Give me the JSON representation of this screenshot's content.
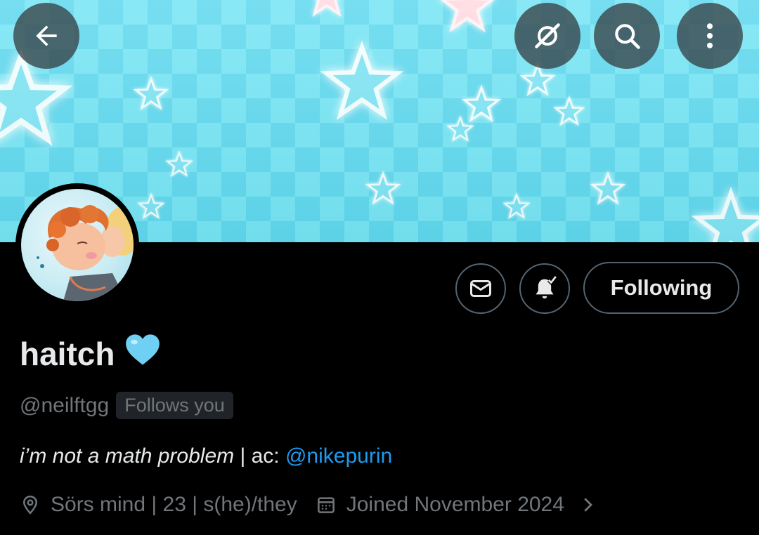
{
  "header": {
    "back_icon": "arrow-left-icon",
    "grok_icon": "grok-icon",
    "search_icon": "search-icon",
    "more_icon": "more-vertical-icon"
  },
  "profile": {
    "display_name": "haitch",
    "name_emoji": "🩵",
    "handle": "@neilftgg",
    "follows_you": "Follows you",
    "bio_italic": "i’m not a math problem",
    "bio_sep": " | ac: ",
    "bio_mention": "@nikepurin",
    "location": "Sörs mind | 23 | s(he)/they",
    "joined": "Joined November 2024"
  },
  "actions": {
    "message_icon": "envelope-icon",
    "notify_icon": "bell-check-icon",
    "following_label": "Following"
  },
  "colors": {
    "accent": "#1d9bf0",
    "muted": "#71767b",
    "border": "#536471",
    "banner": "#5fd8ee"
  }
}
